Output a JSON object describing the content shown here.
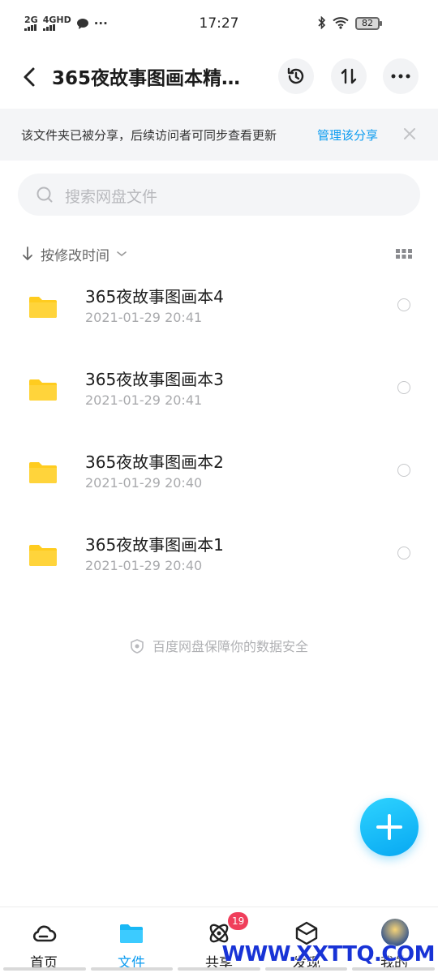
{
  "status_bar": {
    "time": "17:27",
    "signal_1": "2G",
    "signal_2": "4GHD",
    "more": "···",
    "battery": "82"
  },
  "header": {
    "title": "365夜故事图画本精…",
    "icons": [
      "back-icon",
      "history-icon",
      "transfer-icon",
      "more-icon"
    ]
  },
  "share_banner": {
    "message": "该文件夹已被分享，后续访问者可同步查看更新",
    "manage_link": "管理该分享",
    "close_icon": "close-icon"
  },
  "search": {
    "placeholder": "搜索网盘文件"
  },
  "sort": {
    "label": "按修改时间"
  },
  "files": [
    {
      "name": "365夜故事图画本4",
      "date": "2021-01-29   20:41"
    },
    {
      "name": "365夜故事图画本3",
      "date": "2021-01-29   20:41"
    },
    {
      "name": "365夜故事图画本2",
      "date": "2021-01-29   20:40"
    },
    {
      "name": "365夜故事图画本1",
      "date": "2021-01-29   20:40"
    }
  ],
  "footer_note": "百度网盘保障你的数据安全",
  "tabbar": {
    "tabs": [
      {
        "label": "首页",
        "icon": "cloud-icon"
      },
      {
        "label": "文件",
        "icon": "folder-icon"
      },
      {
        "label": "共享",
        "icon": "atom-icon",
        "badge": "19"
      },
      {
        "label": "发现",
        "icon": "cube-icon"
      },
      {
        "label": "我的",
        "icon": "avatar"
      }
    ]
  },
  "watermark": "WWW.XXTTQ.COM",
  "colors": {
    "accent": "#0a9bf0",
    "folder": "#ffcc1f",
    "badge": "#f03e5b"
  }
}
